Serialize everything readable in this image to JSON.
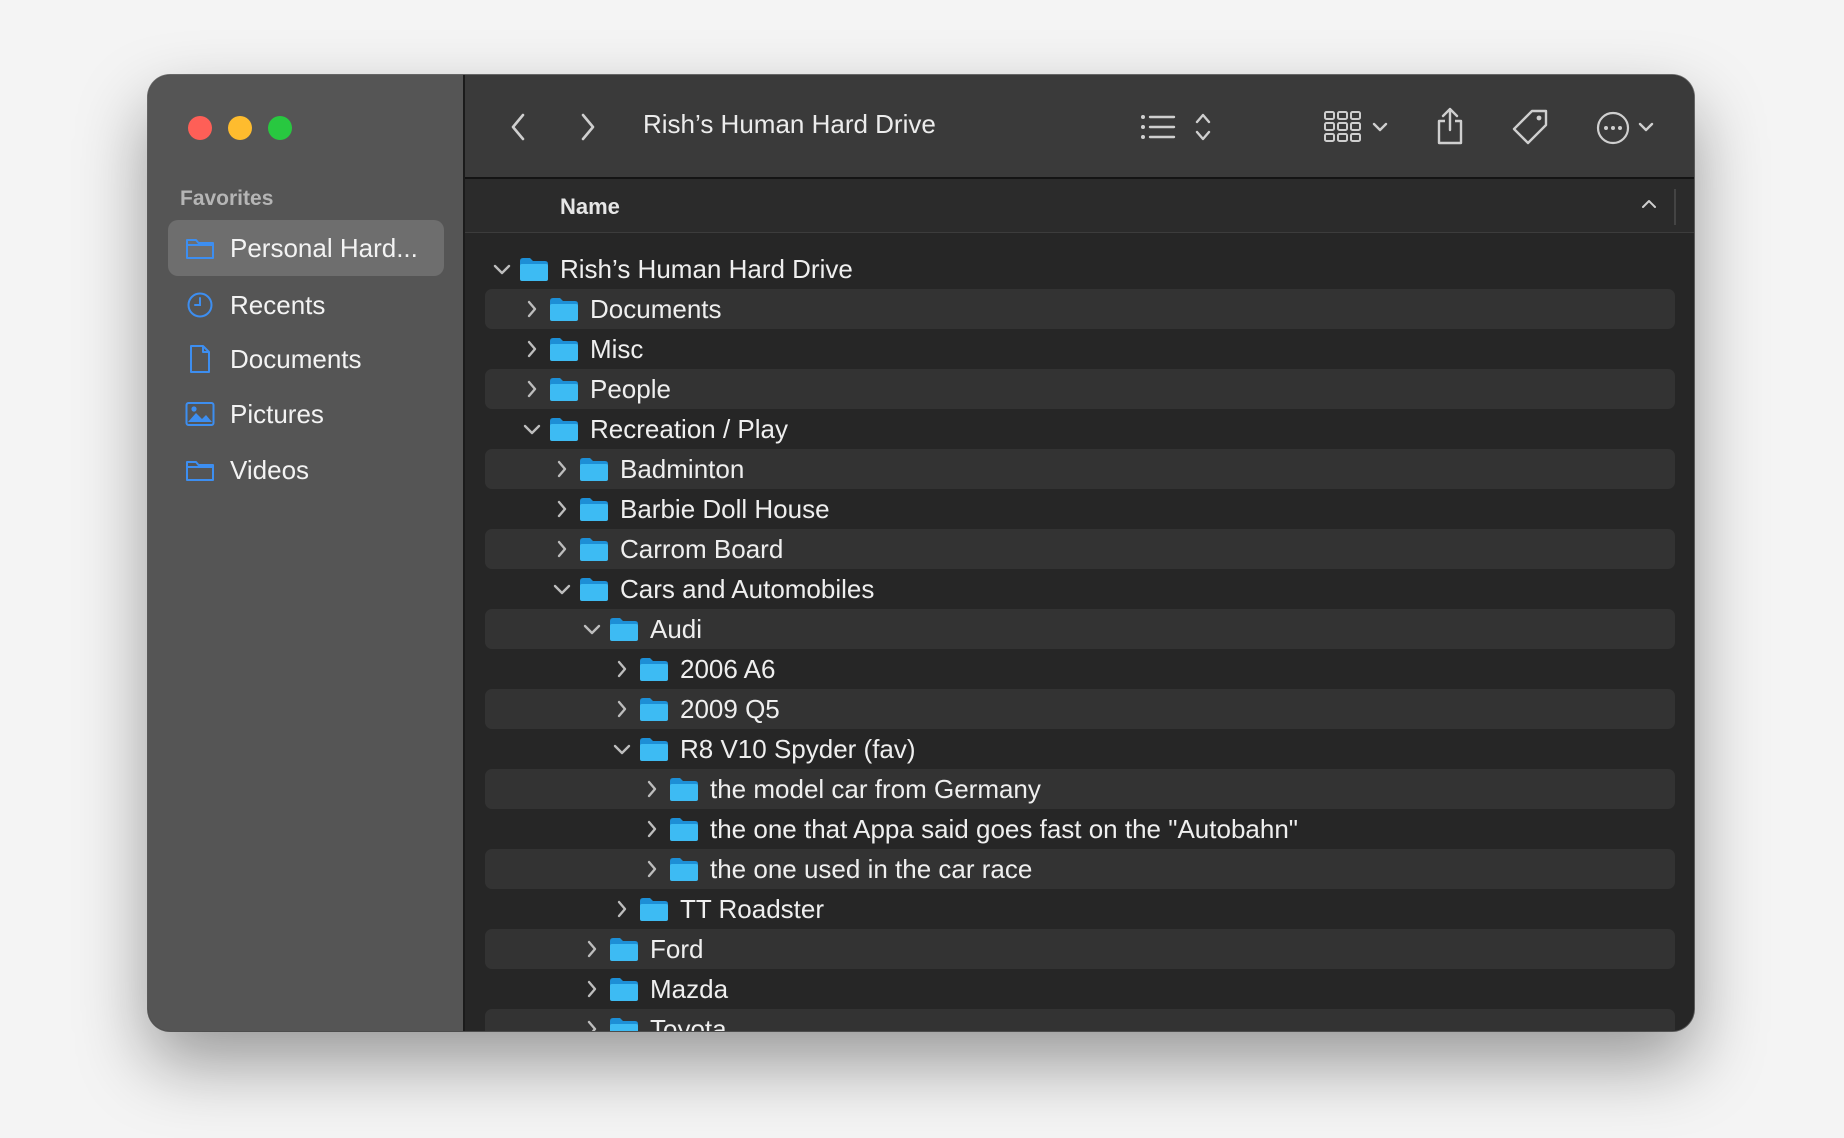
{
  "sidebar": {
    "heading": "Favorites",
    "items": [
      {
        "label": "Personal Hard...",
        "icon": "folder-icon",
        "selected": true
      },
      {
        "label": "Recents",
        "icon": "clock-icon",
        "selected": false
      },
      {
        "label": "Documents",
        "icon": "document-icon",
        "selected": false
      },
      {
        "label": "Pictures",
        "icon": "photo-icon",
        "selected": false
      },
      {
        "label": "Videos",
        "icon": "folder-icon",
        "selected": false
      }
    ]
  },
  "toolbar": {
    "title": "Rish’s Human Hard Drive",
    "icons": [
      "back-icon",
      "forward-icon",
      "list-view-icon",
      "sort-icon",
      "grid-view-icon",
      "share-icon",
      "tag-icon",
      "more-icon",
      "search-icon"
    ]
  },
  "column": {
    "name": "Name"
  },
  "tree": [
    {
      "label": "Rish’s Human Hard Drive",
      "depth": 0,
      "expanded": true
    },
    {
      "label": "Documents",
      "depth": 1,
      "expanded": false
    },
    {
      "label": "Misc",
      "depth": 1,
      "expanded": false
    },
    {
      "label": "People",
      "depth": 1,
      "expanded": false
    },
    {
      "label": "Recreation / Play",
      "depth": 1,
      "expanded": true
    },
    {
      "label": "Badminton",
      "depth": 2,
      "expanded": false
    },
    {
      "label": "Barbie Doll House",
      "depth": 2,
      "expanded": false
    },
    {
      "label": "Carrom Board",
      "depth": 2,
      "expanded": false
    },
    {
      "label": "Cars and Automobiles",
      "depth": 2,
      "expanded": true
    },
    {
      "label": "Audi",
      "depth": 3,
      "expanded": true
    },
    {
      "label": "2006 A6",
      "depth": 4,
      "expanded": false
    },
    {
      "label": "2009 Q5",
      "depth": 4,
      "expanded": false
    },
    {
      "label": "R8 V10 Spyder (fav)",
      "depth": 4,
      "expanded": true
    },
    {
      "label": "the model car from Germany",
      "depth": 5,
      "expanded": false
    },
    {
      "label": "the one that Appa said goes fast on the \"Autobahn\"",
      "depth": 5,
      "expanded": false
    },
    {
      "label": "the one used in the car race",
      "depth": 5,
      "expanded": false
    },
    {
      "label": "TT Roadster",
      "depth": 4,
      "expanded": false
    },
    {
      "label": "Ford",
      "depth": 3,
      "expanded": false
    },
    {
      "label": "Mazda",
      "depth": 3,
      "expanded": false
    },
    {
      "label": "Toyota",
      "depth": 3,
      "expanded": false
    }
  ],
  "colors": {
    "accent": "#3d8ef0",
    "folder_front": "#3dbbf3",
    "folder_back": "#1d8fd6",
    "close": "#fe5f57",
    "minimize": "#febc2e",
    "zoom": "#28c840"
  }
}
